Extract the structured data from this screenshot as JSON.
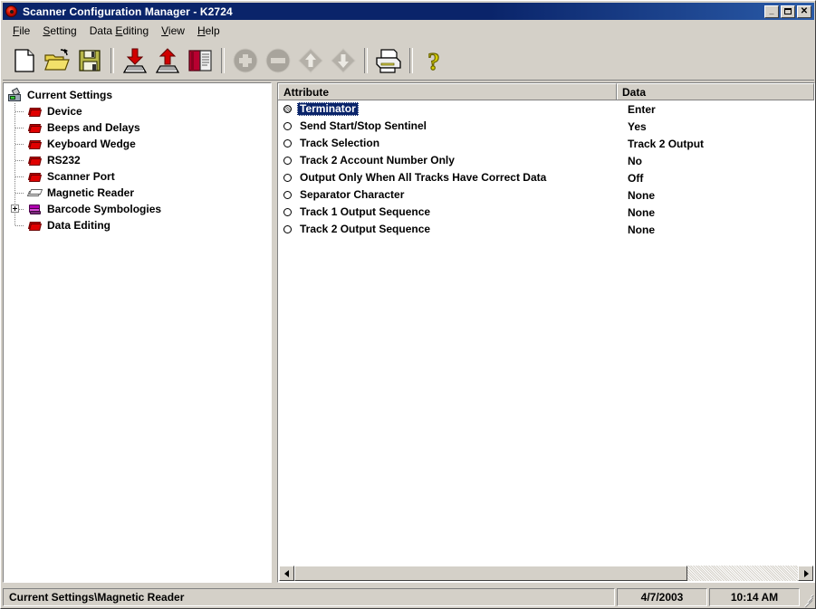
{
  "window": {
    "title": "Scanner Configuration Manager - K2724",
    "icon": "scanner-disc-icon",
    "controls": {
      "minimize": "_",
      "maximize": "",
      "close": "✕"
    }
  },
  "menubar": {
    "items": [
      {
        "label": "File",
        "accel": "F"
      },
      {
        "label": "Setting",
        "accel": "S"
      },
      {
        "label": "Data Editing",
        "accel": "D"
      },
      {
        "label": "View",
        "accel": "V"
      },
      {
        "label": "Help",
        "accel": "H"
      }
    ]
  },
  "toolbar": {
    "buttons": [
      {
        "name": "new-icon",
        "tooltip": "New",
        "enabled": true
      },
      {
        "name": "open-folder-icon",
        "tooltip": "Open",
        "enabled": true
      },
      {
        "name": "save-disk-icon",
        "tooltip": "Save",
        "enabled": true
      },
      {
        "name": "download-to-scanner-icon",
        "tooltip": "Download to Scanner",
        "enabled": true
      },
      {
        "name": "upload-from-scanner-icon",
        "tooltip": "Upload from Scanner",
        "enabled": true
      },
      {
        "name": "barcode-manual-icon",
        "tooltip": "Print Barcode Manual",
        "enabled": true
      },
      {
        "name": "add-icon",
        "tooltip": "Add",
        "enabled": false
      },
      {
        "name": "remove-icon",
        "tooltip": "Remove",
        "enabled": false
      },
      {
        "name": "move-up-icon",
        "tooltip": "Move Up",
        "enabled": false
      },
      {
        "name": "move-down-icon",
        "tooltip": "Move Down",
        "enabled": false
      },
      {
        "name": "print-icon",
        "tooltip": "Print",
        "enabled": true
      },
      {
        "name": "help-icon",
        "tooltip": "Help",
        "enabled": true
      }
    ]
  },
  "tree": {
    "root": {
      "label": "Current Settings",
      "icon": "scanner-icon"
    },
    "items": [
      {
        "label": "Device",
        "icon": "red-book-icon",
        "selected": false,
        "expandable": false
      },
      {
        "label": "Beeps and Delays",
        "icon": "red-book-icon",
        "selected": false,
        "expandable": false
      },
      {
        "label": "Keyboard Wedge",
        "icon": "red-book-icon",
        "selected": false,
        "expandable": false
      },
      {
        "label": "RS232",
        "icon": "red-book-icon",
        "selected": false,
        "expandable": false
      },
      {
        "label": "Scanner Port",
        "icon": "red-book-icon",
        "selected": false,
        "expandable": false
      },
      {
        "label": "Magnetic Reader",
        "icon": "magnetic-card-icon",
        "selected": true,
        "expandable": false
      },
      {
        "label": "Barcode Symbologies",
        "icon": "purple-books-icon",
        "selected": false,
        "expandable": true
      },
      {
        "label": "Data Editing",
        "icon": "red-book-icon",
        "selected": false,
        "expandable": false
      }
    ]
  },
  "list": {
    "columns": [
      "Attribute",
      "Data"
    ],
    "rows": [
      {
        "attribute": "Terminator",
        "data": "Enter",
        "selected": true
      },
      {
        "attribute": "Send Start/Stop Sentinel",
        "data": "Yes",
        "selected": false
      },
      {
        "attribute": "Track Selection",
        "data": "Track 2 Output",
        "selected": false
      },
      {
        "attribute": "Track 2 Account Number Only",
        "data": "No",
        "selected": false
      },
      {
        "attribute": "Output Only When All Tracks Have Correct Data",
        "data": "Off",
        "selected": false
      },
      {
        "attribute": "Separator Character",
        "data": "None",
        "selected": false
      },
      {
        "attribute": "Track 1 Output Sequence",
        "data": "None",
        "selected": false
      },
      {
        "attribute": "Track 2 Output Sequence",
        "data": "None",
        "selected": false
      }
    ]
  },
  "statusbar": {
    "path": "Current Settings\\Magnetic Reader",
    "date": "4/7/2003",
    "time": "10:14 AM"
  },
  "colors": {
    "titlebar_start": "#0a246a",
    "titlebar_end": "#2a5ba8",
    "face": "#d4d0c8",
    "selection": "#0a246a",
    "book_red": "#c00000",
    "book_purple": "#b000b0"
  }
}
